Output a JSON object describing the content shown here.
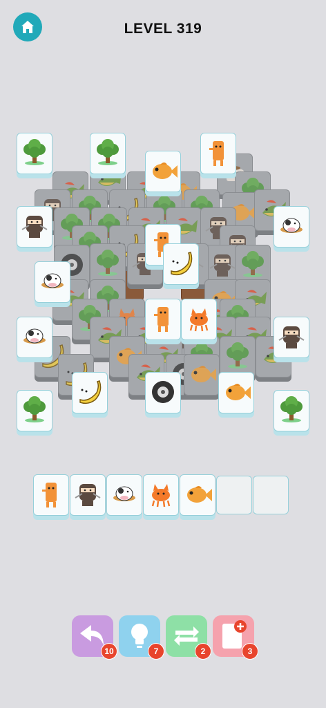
{
  "header": {
    "title": "LEVEL 319",
    "home_icon": "home-icon"
  },
  "colors": {
    "accent": "#21a9b9",
    "badge": "#e8452d"
  },
  "tray": {
    "capacity": 7,
    "items": [
      "stick-creature",
      "ninja",
      "cow",
      "cat",
      "fish"
    ]
  },
  "boosters": [
    {
      "name": "undo",
      "icon": "undo-icon",
      "count": "10",
      "color": "#c99be0"
    },
    {
      "name": "hint",
      "icon": "lightbulb-icon",
      "count": "7",
      "color": "#8fd2ee"
    },
    {
      "name": "shuffle",
      "icon": "shuffle-icon",
      "count": "2",
      "color": "#8ee0a6"
    },
    {
      "name": "add-slot",
      "icon": "add-card-icon",
      "count": "3",
      "color": "#f5a2ad"
    }
  ]
}
